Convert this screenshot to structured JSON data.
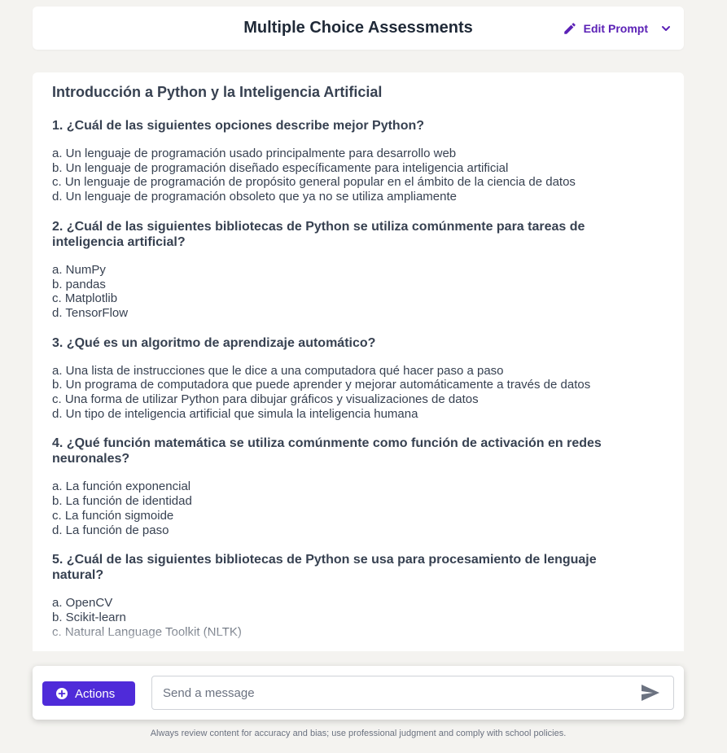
{
  "header": {
    "title": "Multiple Choice Assessments",
    "edit_prompt_label": "Edit Prompt",
    "accent_color": "#5b21b6"
  },
  "document": {
    "title": "Introducción a Python y la Inteligencia Artificial",
    "questions": [
      {
        "text": "1. ¿Cuál de las siguientes opciones describe mejor Python?",
        "options": [
          "a. Un lenguaje de programación usado principalmente para desarrollo web",
          "b. Un lenguaje de programación diseñado específicamente para inteligencia artificial",
          "c. Un lenguaje de programación de propósito general popular en el ámbito de la ciencia de datos",
          "d. Un lenguaje de programación obsoleto que ya no se utiliza ampliamente"
        ]
      },
      {
        "text": "2. ¿Cuál de las siguientes bibliotecas de Python se utiliza comúnmente para tareas de inteligencia artificial?",
        "options": [
          "a. NumPy",
          "b. pandas",
          "c. Matplotlib",
          "d. TensorFlow"
        ]
      },
      {
        "text": "3. ¿Qué es un algoritmo de aprendizaje automático?",
        "options": [
          "a. Una lista de instrucciones que le dice a una computadora qué hacer paso a paso",
          "b. Un programa de computadora que puede aprender y mejorar automáticamente a través de datos",
          "c. Una forma de utilizar Python para dibujar gráficos y visualizaciones de datos",
          "d. Un tipo de inteligencia artificial que simula la inteligencia humana"
        ]
      },
      {
        "text": "4. ¿Qué función matemática se utiliza comúnmente como función de activación en redes neuronales?",
        "options": [
          "a. La función exponencial",
          "b. La función de identidad",
          "c. La función sigmoide",
          "d. La función de paso"
        ]
      },
      {
        "text": "5. ¿Cuál de las siguientes bibliotecas de Python se usa para procesamiento de lenguaje natural?",
        "options": [
          "a. OpenCV",
          "b. Scikit-learn",
          "c. Natural Language Toolkit (NLTK)"
        ]
      }
    ]
  },
  "composer": {
    "actions_label": "Actions",
    "message_placeholder": "Send a message",
    "message_value": "",
    "button_color": "#4f2bd9"
  },
  "footer": {
    "disclaimer": "Always review content for accuracy and bias; use professional judgment and comply with school policies."
  },
  "icons": {
    "edit": "pencil-icon",
    "expand": "chevron-down-icon",
    "actions": "plus-circle-icon",
    "send": "send-icon"
  }
}
